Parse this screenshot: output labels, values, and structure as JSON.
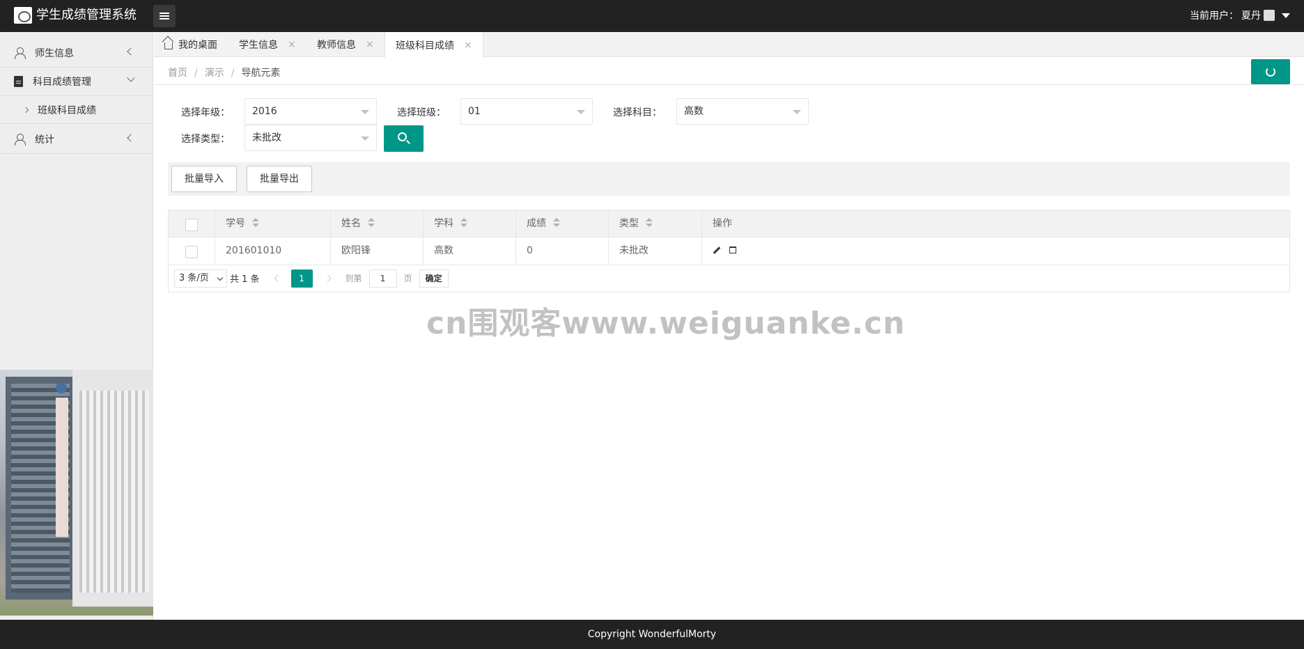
{
  "header": {
    "title": "学生成绩管理系统",
    "user_label": "当前用户：",
    "user_name": "夏丹"
  },
  "sidebar": {
    "items": [
      {
        "label": "师生信息",
        "icon": "user-icon"
      },
      {
        "label": "科目成绩管理",
        "icon": "document-icon"
      },
      {
        "label": "统计",
        "icon": "user-icon"
      }
    ],
    "sub_items": [
      {
        "label": "班级科目成绩"
      }
    ]
  },
  "tabs": [
    {
      "label": "我的桌面",
      "icon": "home-icon"
    },
    {
      "label": "学生信息",
      "close": "×"
    },
    {
      "label": "教师信息",
      "close": "×"
    },
    {
      "label": "班级科目成绩",
      "close": "×",
      "active": true
    }
  ],
  "breadcrumb": {
    "items": [
      "首页",
      "演示",
      "导航元素"
    ],
    "separator": "/"
  },
  "filters": {
    "grade_label": "选择年级：",
    "grade_value": "2016",
    "class_label": "选择班级：",
    "class_value": "01",
    "subject_label": "选择科目：",
    "subject_value": "高数",
    "type_label": "选择类型：",
    "type_value": "未批改"
  },
  "toolbar": {
    "import_label": "批量导入",
    "export_label": "批量导出"
  },
  "table": {
    "columns": [
      "学号",
      "姓名",
      "学科",
      "成绩",
      "类型",
      "操作"
    ],
    "rows": [
      {
        "id": "201601010",
        "name": "欧阳锋",
        "subject": "高数",
        "score": "0",
        "type": "未批改"
      }
    ]
  },
  "pager": {
    "page_size": "3 条/页",
    "total": "共 1 条",
    "current_page": "1",
    "goto_label": "到第",
    "goto_value": "1",
    "page_label": "页",
    "confirm_label": "确定"
  },
  "watermark": "cn围观客www.weiguanke.cn",
  "footer": {
    "copyright": "Copyright WonderfulMorty"
  },
  "colors": {
    "primary": "#009688",
    "header_bg": "#222222",
    "sidebar_bg": "#eeeeee"
  }
}
